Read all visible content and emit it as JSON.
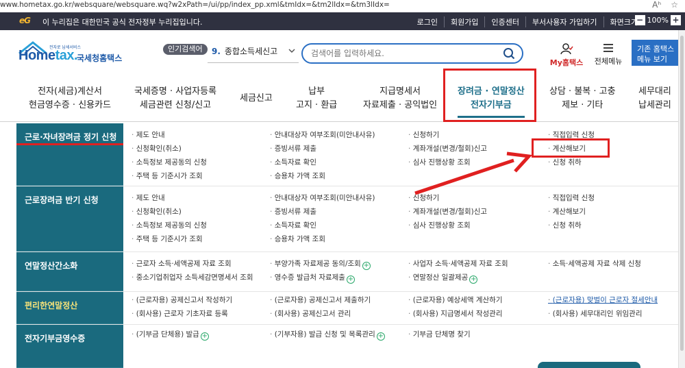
{
  "browser": {
    "url": "www.hometax.go.kr/websquare/websquare.wq?w2xPath=/ui/pp/index_pp.xml&tmIdx=&tm2lIdx=&tm3lIdx=",
    "reader_icon": "Aʰ",
    "fav_icon": "☆"
  },
  "gov_banner": {
    "logo": "eG",
    "text": "이 누리집은 대한민국 공식 전자정부 누리집입니다.",
    "links": [
      "로그인",
      "회원가입",
      "인증센터",
      "부서사용자 가입하기",
      "화면크기"
    ],
    "zoom_minus": "−",
    "zoom_value": "100%",
    "zoom_plus": "+"
  },
  "header": {
    "logo_small": "전자로 납세서비스",
    "logo_home": "Home",
    "logo_tax": "tax.",
    "logo_kor": "국세청홈택스",
    "popular_label": "인기검색어",
    "popular_num": "9.",
    "popular_term": "종합소득세신고",
    "search_placeholder": "검색어를 입력하세요.",
    "my_hometax_my": "My",
    "my_hometax_label": "홈택스",
    "all_menu": "전체메뉴",
    "biz_btn_line1": "기존 홈택스",
    "biz_btn_line2": "메뉴 보기"
  },
  "mainnav": [
    {
      "l1": "전자(세금)계산서",
      "l2": "현금영수증 · 신용카드"
    },
    {
      "l1": "국세증명 · 사업자등록",
      "l2": "세금관련 신청/신고"
    },
    {
      "l1": "세금신고",
      "l2": ""
    },
    {
      "l1": "납부",
      "l2": "고지 · 환급"
    },
    {
      "l1": "지급명세서",
      "l2": "자료제출 · 공익법인"
    },
    {
      "l1": "장려금 · 연말정산",
      "l2": "전자기부금"
    },
    {
      "l1": "상담 · 불복 · 고충",
      "l2": "제보 · 기타"
    },
    {
      "l1": "세무대리",
      "l2": "납세관리"
    }
  ],
  "menu": {
    "s1": {
      "title": "근로·자녀장려금 정기 신청",
      "c1": [
        "제도 안내",
        "신청확인(취소)",
        "소득정보 제공동의 신청",
        "주택 등 기준시가 조회"
      ],
      "c2": [
        "안내대상자 여부조회(미안내사유)",
        "증빙서류 제출",
        "소득자료 확인",
        "승용차 가액 조회"
      ],
      "c3": [
        "신청하기",
        "계좌개설(변경/철회)신고",
        "심사 진행상황 조회"
      ],
      "c4": [
        "직접입력 신청",
        "계산해보기",
        "신청 취하"
      ]
    },
    "s2": {
      "title": "근로장려금 반기 신청",
      "c1": [
        "제도 안내",
        "신청확인(취소)",
        "소득정보 제공동의 신청",
        "주택 등 기준시가 조회"
      ],
      "c2": [
        "안내대상자 여부조회(미안내사유)",
        "증빙서류 제출",
        "소득자료 확인",
        "승용차 가액 조회"
      ],
      "c3": [
        "신청하기",
        "계좌개설(변경/철회)신고",
        "심사 진행상황 조회"
      ],
      "c4": [
        "직접입력 신청",
        "계산해보기",
        "신청 취하"
      ]
    },
    "s3": {
      "title": "연말정산간소화",
      "c1": [
        "근로자 소득·세액공제 자료 조회",
        "중소기업취업자 소득세감면명세서 조회"
      ],
      "c2": [
        "부양가족 자료제공 동의/조회",
        "영수증 발급처 자료제출"
      ],
      "c3": [
        "사업자 소득·세액공제 자료 조회",
        "연말정산 일괄제공"
      ],
      "c4": [
        "소득·세액공제 자료 삭제 신청"
      ]
    },
    "s4": {
      "title": "편리한연말정산",
      "c1": [
        "(근로자용) 공제신고서 작성하기",
        "(회사용) 근로자 기초자료 등록"
      ],
      "c2": [
        "(근로자용) 공제신고서 제출하기",
        "(회사용) 공제신고서 관리"
      ],
      "c3": [
        "(근로자용) 예상세액 계산하기",
        "(회사용) 지급명세서 작성관리"
      ],
      "c4": [
        "(근로자용) 맞벌이 근로자 절세안내",
        "(회사용) 세무대리인 위임관리"
      ]
    },
    "s5": {
      "title": "전자기부금영수증",
      "c1": [
        "(기부금 단체용) 발급"
      ],
      "c2": [
        "(기부자용) 발급 신청 및 목록관리"
      ],
      "c3": [
        "기부금 단체명 찾기"
      ]
    }
  },
  "plus_glyph": "+",
  "colors": {
    "teal": "#1a6a7e",
    "highlight_red": "#e02020",
    "brand_blue": "#1e5aa8"
  }
}
